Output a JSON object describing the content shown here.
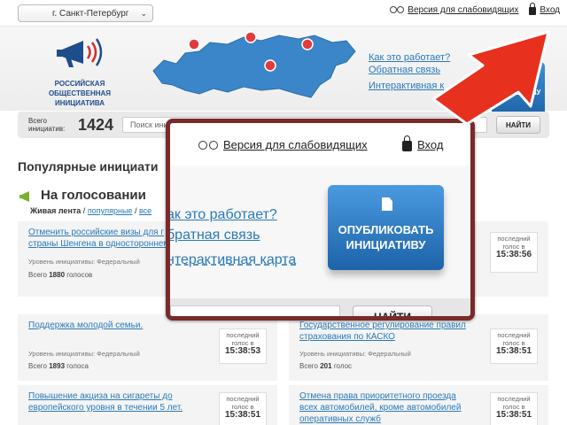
{
  "topbar": {
    "city": "г. Санкт-Петербург",
    "accessibility": "Версия для слабовидящих",
    "login": "Вход"
  },
  "logo": {
    "line1": "РОССИЙСКАЯ",
    "line2": "ОБЩЕСТВЕННАЯ",
    "line3": "ИНИЦИАТИВА"
  },
  "header": {
    "how": "Как это работает?",
    "feedback": "Обратная связь",
    "map": "Интерактивная к",
    "publish": "ОПУБЛИКОВАТЬ ИНИЦИАТИВУ",
    "publish_small": "ОВАТЬ ТИВУ"
  },
  "search": {
    "total_label_1": "Всего",
    "total_label_2": "инициатив:",
    "total": "1424",
    "placeholder": "Поиск ини",
    "button": "НАЙТИ"
  },
  "main": {
    "section_title": "Популярные инициати",
    "voting_title": "На голосовании",
    "tab_live": "Живая лента",
    "tab_popular": "популярные",
    "tab_all": "все"
  },
  "cards": [
    {
      "title": "Отменить российские визы для г страны Шенгена в одностороннем",
      "level": "Уровень инициативы: Федеральный",
      "votes_prefix": "Всего",
      "votes": "1880",
      "votes_suffix": "голосов",
      "last1": "последний",
      "last2": "голос в",
      "time": ""
    },
    {
      "title": "",
      "level": "",
      "votes_prefix": "",
      "votes": "",
      "votes_suffix": "",
      "last1": "последний",
      "last2": "голос в",
      "time": "15:38:56"
    },
    {
      "title": "Поддержка молодой семьи.",
      "level": "Уровень инициативы: Федеральный",
      "votes_prefix": "Всего",
      "votes": "1893",
      "votes_suffix": "голоса",
      "last1": "последний",
      "last2": "голос в",
      "time": "15:38:53"
    },
    {
      "title": "Государственное регулирование правил страхования по КАСКО",
      "level": "Уровень инициативы: Федеральный",
      "votes_prefix": "Всего",
      "votes": "201",
      "votes_suffix": "голос",
      "last1": "последний",
      "last2": "голос в",
      "time": "15:38:51"
    },
    {
      "title": "Повышение акциза на сигареты до европейского уровня в течении 5 лет.",
      "level": "",
      "votes_prefix": "",
      "votes": "",
      "votes_suffix": "",
      "last1": "последний",
      "last2": "голос в",
      "time": "15:38:51"
    },
    {
      "title": "Отмена права приоритетного проезда всех автомобилей, кроме автомобилей оперативных служб",
      "level": "",
      "votes_prefix": "",
      "votes": "",
      "votes_suffix": "",
      "last1": "последний",
      "last2": "голос в",
      "time": "15:38:51"
    }
  ],
  "zoom": {
    "accessibility": "Версия для слабовидящих",
    "login": "Вход",
    "how": "ак это работает?",
    "feedback": "братная связь",
    "map": "нтерактивная карта",
    "publish_1": "ОПУБЛИКОВАТЬ",
    "publish_2": "ИНИЦИАТИВУ",
    "search_button": "НАЙТИ"
  },
  "colors": {
    "link": "#2a7ab8",
    "publish": "#1d63a8",
    "highlight_border": "#7a2a2a",
    "arrow": "#e8301f"
  },
  "icons": [
    "glasses-icon",
    "lock-icon",
    "megaphone-icon",
    "map-pin-icon",
    "document-icon",
    "chevron-down-icon",
    "pointer-arrow-icon"
  ]
}
